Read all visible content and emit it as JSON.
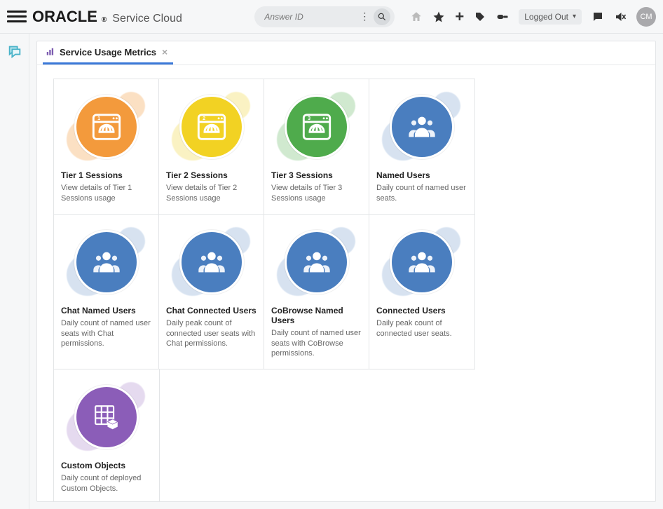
{
  "header": {
    "brand_main": "ORACLE",
    "brand_reg": "®",
    "brand_sub": "Service Cloud",
    "search_placeholder": "Answer ID",
    "logged_out_label": "Logged Out",
    "avatar_initials": "CM"
  },
  "tab": {
    "label": "Service Usage Metrics"
  },
  "cards": [
    {
      "title": "Tier 1 Sessions",
      "desc": "View details of Tier 1 Sessions usage",
      "icon": "browser",
      "color": "orange",
      "badge": "1"
    },
    {
      "title": "Tier 2 Sessions",
      "desc": "View details of Tier 2 Sessions usage",
      "icon": "browser",
      "color": "yellow",
      "badge": "2"
    },
    {
      "title": "Tier 3 Sessions",
      "desc": "View details of Tier 3 Sessions usage",
      "icon": "browser",
      "color": "green",
      "badge": "3"
    },
    {
      "title": "Named Users",
      "desc": "Daily count of named user seats.",
      "icon": "people",
      "color": "blue"
    },
    {
      "title": "Chat Named Users",
      "desc": "Daily count of named user seats with Chat permissions.",
      "icon": "people",
      "color": "blue"
    },
    {
      "title": "Chat Connected Users",
      "desc": "Daily peak count of connected user seats with Chat permissions.",
      "icon": "people",
      "color": "blue"
    },
    {
      "title": "CoBrowse Named Users",
      "desc": "Daily count of named user seats with CoBrowse permissions.",
      "icon": "people",
      "color": "blue"
    },
    {
      "title": "Connected Users",
      "desc": "Daily peak count of connected user seats.",
      "icon": "people",
      "color": "blue"
    },
    {
      "title": "Custom Objects",
      "desc": "Daily count of deployed Custom Objects.",
      "icon": "objects",
      "color": "purple"
    }
  ]
}
